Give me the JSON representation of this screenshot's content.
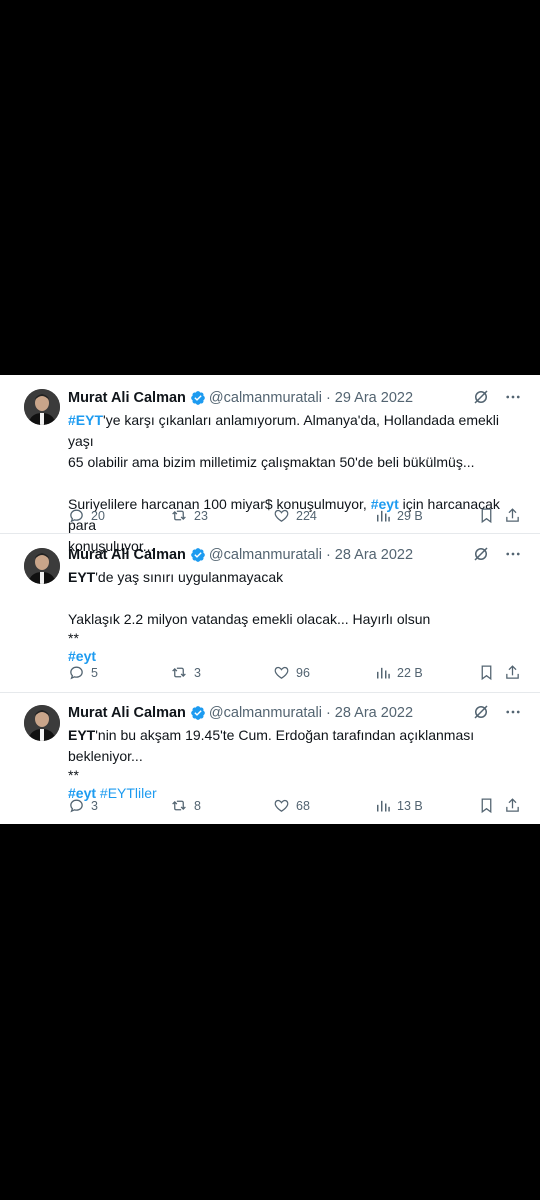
{
  "tweets": [
    {
      "author": "Murat Ali Calman",
      "handle": "@calmanmuratali",
      "date": "· 29 Ara 2022",
      "lines": [
        {
          "hashtag": "#EYT",
          "text": "'ye karşı çıkanları anlamıyorum. Almanya'da, Hollandada emekli yaşı"
        },
        {
          "text": "65 olabilir ama bizim milletimiz çalışmaktan 50'de beli bükülmüş..."
        },
        {
          "text": ""
        },
        {
          "text_before": "Suriyelilere harcanan 100 miyar$ konuşulmuyor, ",
          "hashtag": "#eyt",
          "text_after": " için harcanacak para"
        },
        {
          "text": "konuşuluyor..."
        }
      ],
      "replies": "20",
      "retweets": "23",
      "likes": "224",
      "views": "29 B"
    },
    {
      "author": "Murat Ali Calman",
      "handle": "@calmanmuratali",
      "date": "· 28 Ara 2022",
      "lines": [
        {
          "bold": "EYT",
          "text": "'de yaş sınırı uygulanmayacak"
        },
        {
          "text": ""
        },
        {
          "text": "Yaklaşık 2.2 milyon vatandaş emekli olacak... Hayırlı olsun"
        },
        {
          "text": "**"
        },
        {
          "hashtag": "#eyt"
        }
      ],
      "replies": "5",
      "retweets": "3",
      "likes": "96",
      "views": "22 B"
    },
    {
      "author": "Murat Ali Calman",
      "handle": "@calmanmuratali",
      "date": "· 28 Ara 2022",
      "lines": [
        {
          "bold": "EYT",
          "text": "'nin bu akşam 19.45'te Cum. Erdoğan tarafından açıklanması"
        },
        {
          "text": "bekleniyor..."
        },
        {
          "text": "**"
        },
        {
          "hashtag": "#eyt",
          "hashtag2": "#EYTliler"
        }
      ],
      "replies": "3",
      "retweets": "8",
      "likes": "68",
      "views": "13 B"
    }
  ],
  "colors": {
    "accent": "#1d9bf0",
    "text": "#0f1419",
    "muted": "#536471"
  },
  "icons": [
    "verified-badge-icon",
    "grok-icon",
    "more-icon",
    "reply-icon",
    "retweet-icon",
    "like-icon",
    "views-icon",
    "bookmark-icon",
    "share-icon"
  ]
}
